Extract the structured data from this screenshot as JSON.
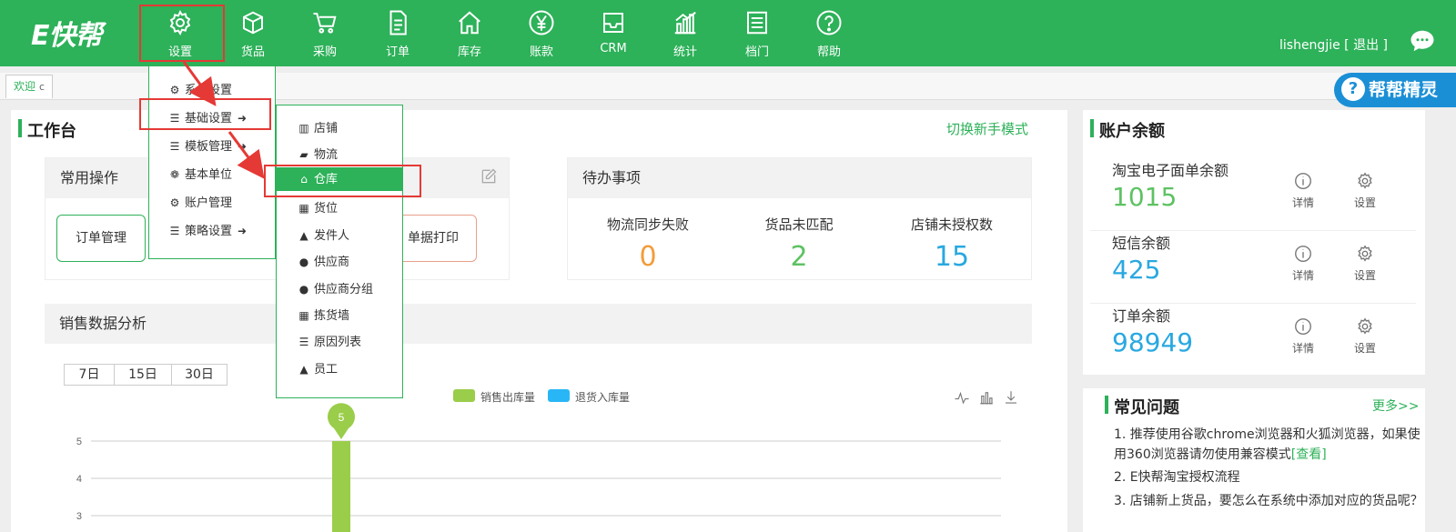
{
  "app": {
    "logo": "E快帮",
    "nav": [
      {
        "label": "设置",
        "icon": "gear-icon"
      },
      {
        "label": "货品",
        "icon": "box-icon"
      },
      {
        "label": "采购",
        "icon": "cart-icon"
      },
      {
        "label": "订单",
        "icon": "document-icon"
      },
      {
        "label": "库存",
        "icon": "house-icon"
      },
      {
        "label": "账款",
        "icon": "yen-icon"
      },
      {
        "label": "CRM",
        "icon": "inbox-icon"
      },
      {
        "label": "统计",
        "icon": "bar-chart-icon"
      },
      {
        "label": "档门",
        "icon": "list-icon"
      },
      {
        "label": "帮助",
        "icon": "question-icon"
      }
    ],
    "user": {
      "name": "lishengjie",
      "logout": "[ 退出 ]"
    },
    "helper": "帮帮精灵",
    "accent": "#2db159"
  },
  "tabs": [
    {
      "label": "欢迎",
      "close": "c"
    }
  ],
  "settings_menu": [
    {
      "label": "系统设置",
      "icon": "gears-icon"
    },
    {
      "label": "基础设置",
      "icon": "bars-icon",
      "has_sub": true
    },
    {
      "label": "模板管理",
      "icon": "bars-icon",
      "has_sub": true
    },
    {
      "label": "基本单位",
      "icon": "paw-icon"
    },
    {
      "label": "账户管理",
      "icon": "gear-icon"
    },
    {
      "label": "策略设置",
      "icon": "bars-icon",
      "has_sub": true
    }
  ],
  "basic_submenu": [
    {
      "label": "店铺",
      "icon": "bank-icon"
    },
    {
      "label": "物流",
      "icon": "truck-icon"
    },
    {
      "label": "仓库",
      "icon": "home-icon",
      "active": true
    },
    {
      "label": "货位",
      "icon": "grid-icon"
    },
    {
      "label": "发件人",
      "icon": "user-icon"
    },
    {
      "label": "供应商",
      "icon": "users-icon"
    },
    {
      "label": "供应商分组",
      "icon": "users-icon"
    },
    {
      "label": "拣货墙",
      "icon": "grid-icon"
    },
    {
      "label": "原因列表",
      "icon": "list-icon"
    },
    {
      "label": "员工",
      "icon": "user-icon"
    }
  ],
  "workbench": {
    "title": "工作台",
    "switch_mode": "切换新手模式",
    "common_ops": {
      "title": "常用操作",
      "buttons": [
        "订单管理",
        "单据打印"
      ]
    },
    "todo": {
      "title": "待办事项",
      "items": [
        {
          "label": "物流同步失败",
          "value": "0",
          "color": "#f39c3a"
        },
        {
          "label": "货品未匹配",
          "value": "2",
          "color": "#5ec263"
        },
        {
          "label": "店铺未授权数",
          "value": "15",
          "color": "#29a8e0"
        }
      ]
    },
    "sales": {
      "title": "销售数据分析",
      "ranges": [
        "7日",
        "15日",
        "30日"
      ],
      "legend": [
        {
          "label": "销售出库量",
          "color": "#9acd4a"
        },
        {
          "label": "退货入库量",
          "color": "#29b6f6"
        }
      ],
      "tooltip": "5"
    }
  },
  "chart_data": {
    "type": "bar",
    "series": [
      {
        "name": "销售出库量",
        "color": "#9acd4a",
        "values": [
          5
        ]
      },
      {
        "name": "退货入库量",
        "color": "#29b6f6",
        "values": []
      }
    ],
    "yticks": [
      "5",
      "4",
      "3"
    ],
    "ylim": [
      3,
      5
    ],
    "grid": true,
    "legend": "top"
  },
  "account": {
    "title": "账户余额",
    "rows": [
      {
        "label": "淘宝电子面单余额",
        "value": "1015",
        "color": "#5ec263",
        "detail": "详情",
        "settings": "设置"
      },
      {
        "label": "短信余额",
        "value": "425",
        "color": "#29a8e0",
        "detail": "详情",
        "settings": "设置"
      },
      {
        "label": "订单余额",
        "value": "98949",
        "color": "#29a8e0",
        "detail": "详情",
        "settings": "设置"
      }
    ]
  },
  "faq": {
    "title": "常见问题",
    "more": "更多>>",
    "items": [
      {
        "text": "1. 推荐使用谷歌chrome浏览器和火狐浏览器，如果使用360浏览器请勿使用兼容模式",
        "link": "[查看]"
      },
      {
        "text": "2. E快帮淘宝授权流程",
        "link": ""
      },
      {
        "text": "3. 店铺新上货品，要怎么在系统中添加对应的货品呢？",
        "link": ""
      }
    ]
  }
}
